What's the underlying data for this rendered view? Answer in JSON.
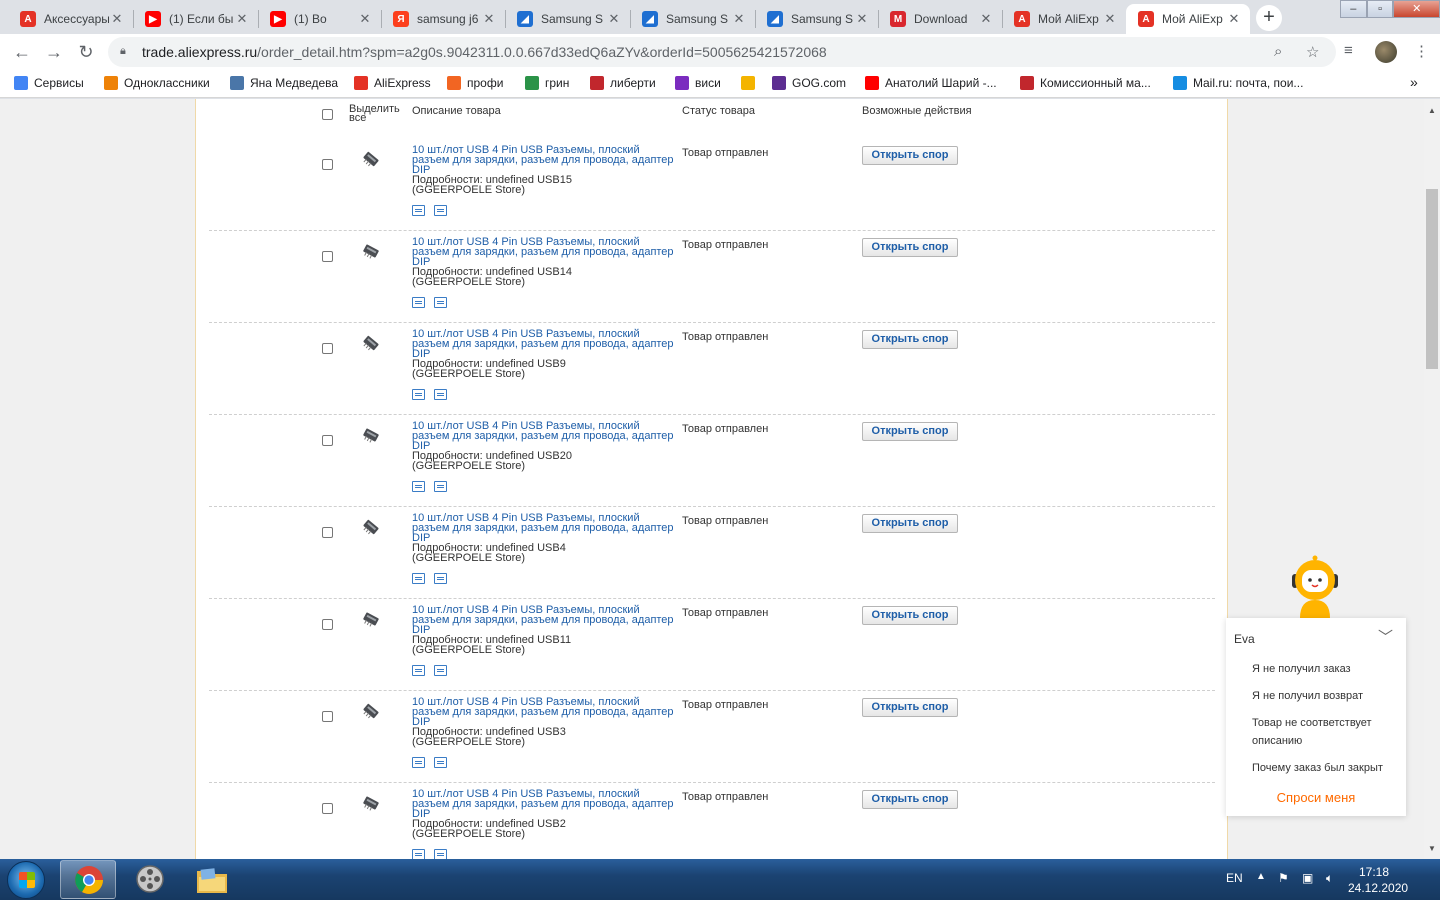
{
  "tabs": [
    {
      "title": "Аксессуары",
      "icon": "aliexpress-icon",
      "color": "#e43225"
    },
    {
      "title": "(1) Если бы",
      "icon": "youtube-icon",
      "color": "#ff0000"
    },
    {
      "title": "(1) Во",
      "icon": "youtube-icon",
      "color": "#ff0000"
    },
    {
      "title": "samsung j6",
      "icon": "yandex-icon",
      "color": "#fc3f1d"
    },
    {
      "title": "Samsung S",
      "icon": "document-icon",
      "color": "#1f6fd1"
    },
    {
      "title": "Samsung S",
      "icon": "document-icon",
      "color": "#1f6fd1"
    },
    {
      "title": "Samsung S",
      "icon": "document-icon",
      "color": "#1f6fd1"
    },
    {
      "title": "Download",
      "icon": "mega-icon",
      "color": "#d9272e"
    },
    {
      "title": "Мой AliExp",
      "icon": "aliexpress-icon",
      "color": "#e43225"
    },
    {
      "title": "Мой AliExp",
      "icon": "aliexpress-icon",
      "color": "#e43225"
    }
  ],
  "address": {
    "host": "trade.aliexpress.ru",
    "path": "/order_detail.htm?spm=a2g0s.9042311.0.0.667d33edQ6aZYv&orderId=5005625421572068"
  },
  "bookmarks": [
    {
      "label": "Сервисы",
      "icon": "apps-grid-icon",
      "color": "#4285f4"
    },
    {
      "label": "Одноклассники",
      "icon": "ok-icon",
      "color": "#ee8208"
    },
    {
      "label": "Яна Медведева",
      "icon": "vk-icon",
      "color": "#4a76a8"
    },
    {
      "label": "AliExpress",
      "icon": "aliexpress-icon",
      "color": "#e43225"
    },
    {
      "label": "профи",
      "icon": "bookmark-icon",
      "color": "#f26522"
    },
    {
      "label": "грин",
      "icon": "bookmark-icon",
      "color": "#2b9348"
    },
    {
      "label": "либерти",
      "icon": "bookmark-icon",
      "color": "#c1272d"
    },
    {
      "label": "виси",
      "icon": "bookmark-icon",
      "color": "#7b2cbf"
    },
    {
      "label": "",
      "icon": "bookmark-icon",
      "color": "#f4b400"
    },
    {
      "label": "GOG.com",
      "icon": "gog-icon",
      "color": "#5c2d91"
    },
    {
      "label": "Анатолий Шарий -...",
      "icon": "youtube-icon",
      "color": "#ff0000"
    },
    {
      "label": "Комиссионный ма...",
      "icon": "bookmark-icon",
      "color": "#c1272d"
    },
    {
      "label": "Mail.ru: почта, пои...",
      "icon": "mailru-icon",
      "color": "#168de2"
    }
  ],
  "table": {
    "select_all": "Выделить все",
    "col_description": "Описание товара",
    "col_status": "Статус товара",
    "col_actions": "Возможные действия"
  },
  "items": [
    {
      "title": "10 шт./лот USB 4 Pin USB Разъемы, плоский разъем для зарядки, разъем для провода, адаптер DIP",
      "details": "Подробности: undefined USB15",
      "store": "(GGEERPOELE Store)",
      "status": "Товар отправлен",
      "action": "Открыть спор"
    },
    {
      "title": "10 шт./лот USB 4 Pin USB Разъемы, плоский разъем для зарядки, разъем для провода, адаптер DIP",
      "details": "Подробности: undefined USB14",
      "store": "(GGEERPOELE Store)",
      "status": "Товар отправлен",
      "action": "Открыть спор"
    },
    {
      "title": "10 шт./лот USB 4 Pin USB Разъемы, плоский разъем для зарядки, разъем для провода, адаптер DIP",
      "details": "Подробности: undefined USB9",
      "store": "(GGEERPOELE Store)",
      "status": "Товар отправлен",
      "action": "Открыть спор"
    },
    {
      "title": "10 шт./лот USB 4 Pin USB Разъемы, плоский разъем для зарядки, разъем для провода, адаптер DIP",
      "details": "Подробности: undefined USB20",
      "store": "(GGEERPOELE Store)",
      "status": "Товар отправлен",
      "action": "Открыть спор"
    },
    {
      "title": "10 шт./лот USB 4 Pin USB Разъемы, плоский разъем для зарядки, разъем для провода, адаптер DIP",
      "details": "Подробности: undefined USB4",
      "store": "(GGEERPOELE Store)",
      "status": "Товар отправлен",
      "action": "Открыть спор"
    },
    {
      "title": "10 шт./лот USB 4 Pin USB Разъемы, плоский разъем для зарядки, разъем для провода, адаптер DIP",
      "details": "Подробности: undefined USB11",
      "store": "(GGEERPOELE Store)",
      "status": "Товар отправлен",
      "action": "Открыть спор"
    },
    {
      "title": "10 шт./лот USB 4 Pin USB Разъемы, плоский разъем для зарядки, разъем для провода, адаптер DIP",
      "details": "Подробности: undefined USB3",
      "store": "(GGEERPOELE Store)",
      "status": "Товар отправлен",
      "action": "Открыть спор"
    },
    {
      "title": "10 шт./лот USB 4 Pin USB Разъемы, плоский разъем для зарядки, разъем для провода, адаптер DIP",
      "details": "Подробности: undefined USB2",
      "store": "(GGEERPOELE Store)",
      "status": "Товар отправлен",
      "action": "Открыть спор"
    }
  ],
  "chat": {
    "name": "Eva",
    "options": [
      "Я не получил заказ",
      "Я не получил возврат",
      "Товар не соответствует описанию",
      "Почему заказ был закрыт"
    ],
    "ask": "Спроси меня"
  },
  "taskbar": {
    "lang": "EN",
    "time": "17:18",
    "date": "24.12.2020"
  }
}
